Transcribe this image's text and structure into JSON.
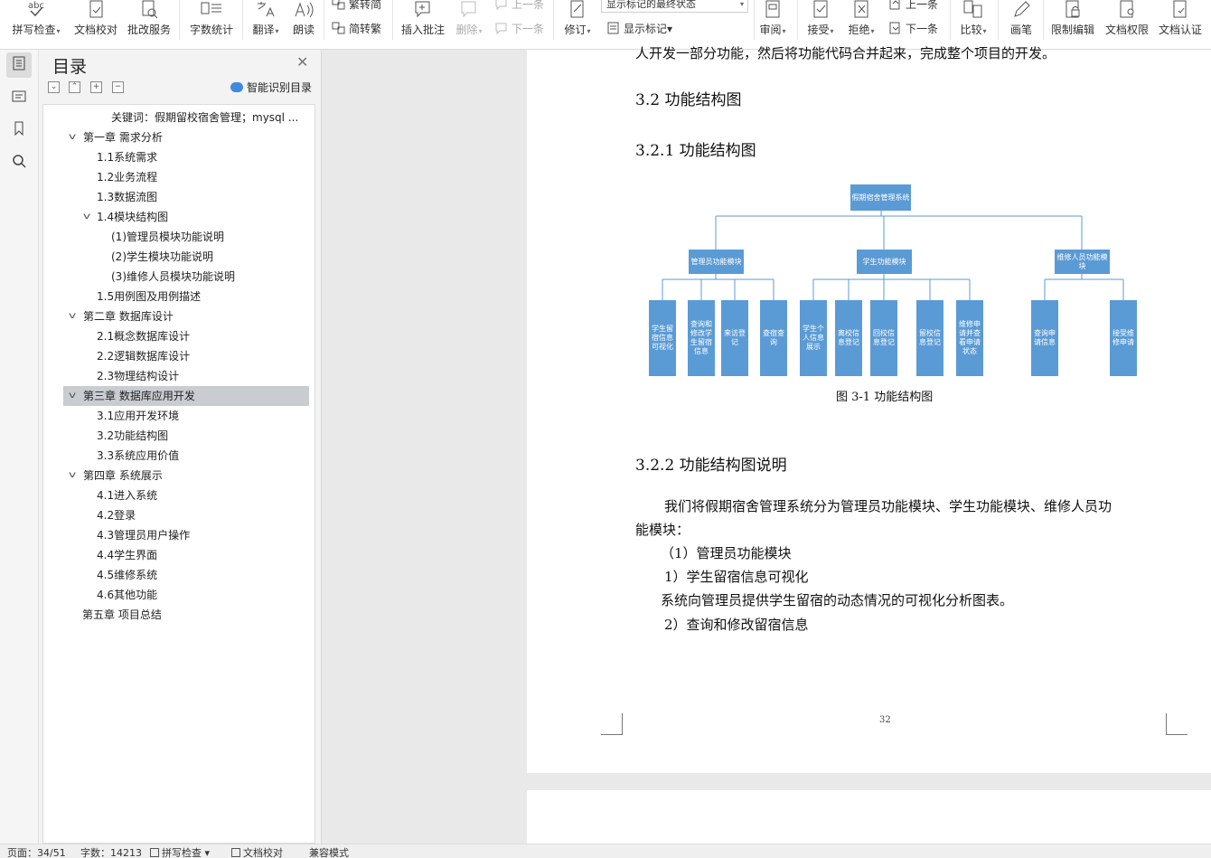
{
  "ribbon": {
    "buttons": {
      "spellcheck": "拼写检查",
      "doc_proof": "文档校对",
      "correction_service": "批改服务",
      "word_count": "字数统计",
      "translate": "翻译",
      "read_aloud": "朗读",
      "trad_to_simp": "繁转简",
      "simp_to_trad": "简转繁",
      "insert_comment": "插入批注",
      "delete": "删除",
      "prev_comment": "上一条",
      "next_comment": "下一条",
      "revise": "修订",
      "markup_mode": "显示标记的最终状态",
      "show_markup": "显示标记",
      "review": "审阅",
      "accept": "接受",
      "reject": "拒绝",
      "prev_change": "上一条",
      "next_change": "下一条",
      "compare": "比较",
      "pen": "画笔",
      "restrict_edit": "限制编辑",
      "doc_permission": "文档权限",
      "doc_cert": "文档认证"
    },
    "icon_text_abc": "abc"
  },
  "toc": {
    "title": "目录",
    "smart_toc": "智能识别目录",
    "items": [
      {
        "label": "关键词：假期留校宿舍管理；mysql ..."
      },
      {
        "label": "第一章  需求分析"
      },
      {
        "label": "1.1系统需求"
      },
      {
        "label": "1.2业务流程"
      },
      {
        "label": "1.3数据流图"
      },
      {
        "label": "1.4模块结构图"
      },
      {
        "label": "(1)管理员模块功能说明"
      },
      {
        "label": "(2)学生模块功能说明"
      },
      {
        "label": "(3)维修人员模块功能说明"
      },
      {
        "label": "1.5用例图及用例描述"
      },
      {
        "label": "第二章  数据库设计"
      },
      {
        "label": "2.1概念数据库设计"
      },
      {
        "label": "2.2逻辑数据库设计"
      },
      {
        "label": "2.3物理结构设计"
      },
      {
        "label": "第三章  数据库应用开发"
      },
      {
        "label": "3.1应用开发环境"
      },
      {
        "label": "3.2功能结构图"
      },
      {
        "label": "3.3系统应用价值"
      },
      {
        "label": "第四章  系统展示"
      },
      {
        "label": "4.1进入系统"
      },
      {
        "label": "4.2登录"
      },
      {
        "label": "4.3管理员用户操作"
      },
      {
        "label": "4.4学生界面"
      },
      {
        "label": "4.5维修系统"
      },
      {
        "label": "4.6其他功能"
      },
      {
        "label": "第五章  项目总结"
      }
    ]
  },
  "document": {
    "line_top": "人开发一部分功能，然后将功能代码合并起来，完成整个项目的开发。",
    "h_32": "3.2  功能结构图",
    "h_321": "3.2.1  功能结构图",
    "figure_caption": "图 3-1 功能结构图",
    "h_322": "3.2.2  功能结构图说明",
    "para1_a": "我们将假期宿舍管理系统分为管理员功能模块、学生功能模块、维修人员功",
    "para1_b": "能模块：",
    "item1": "（1）管理员功能模块",
    "item1_1": "1）学生留宿信息可视化",
    "item1_1_desc": "系统向管理员提供学生留宿的动态情况的可视化分析图表。",
    "item1_2": "2）查询和修改留宿信息",
    "page_number": "32",
    "diagram": {
      "root": "假期宿舍管理系统",
      "modules": [
        "管理员功能模块",
        "学生功能模块",
        "维修人员功能模块"
      ],
      "leaves": [
        "学生留宿信息可视化",
        "查询和修改学生留宿信息",
        "来访登记",
        "查宿查询",
        "学生个人信息展示",
        "离校信息登记",
        "回校信息登记",
        "留校信息登记",
        "维修申请并查看申请状态",
        "查询申请信息",
        "接受维修申请"
      ],
      "color": "#5b9bd5"
    }
  },
  "status": {
    "page": "页面：34/51",
    "words": "字数：14213",
    "spell": "拼写检查",
    "proof": "文档校对",
    "compat": "兼容模式"
  }
}
